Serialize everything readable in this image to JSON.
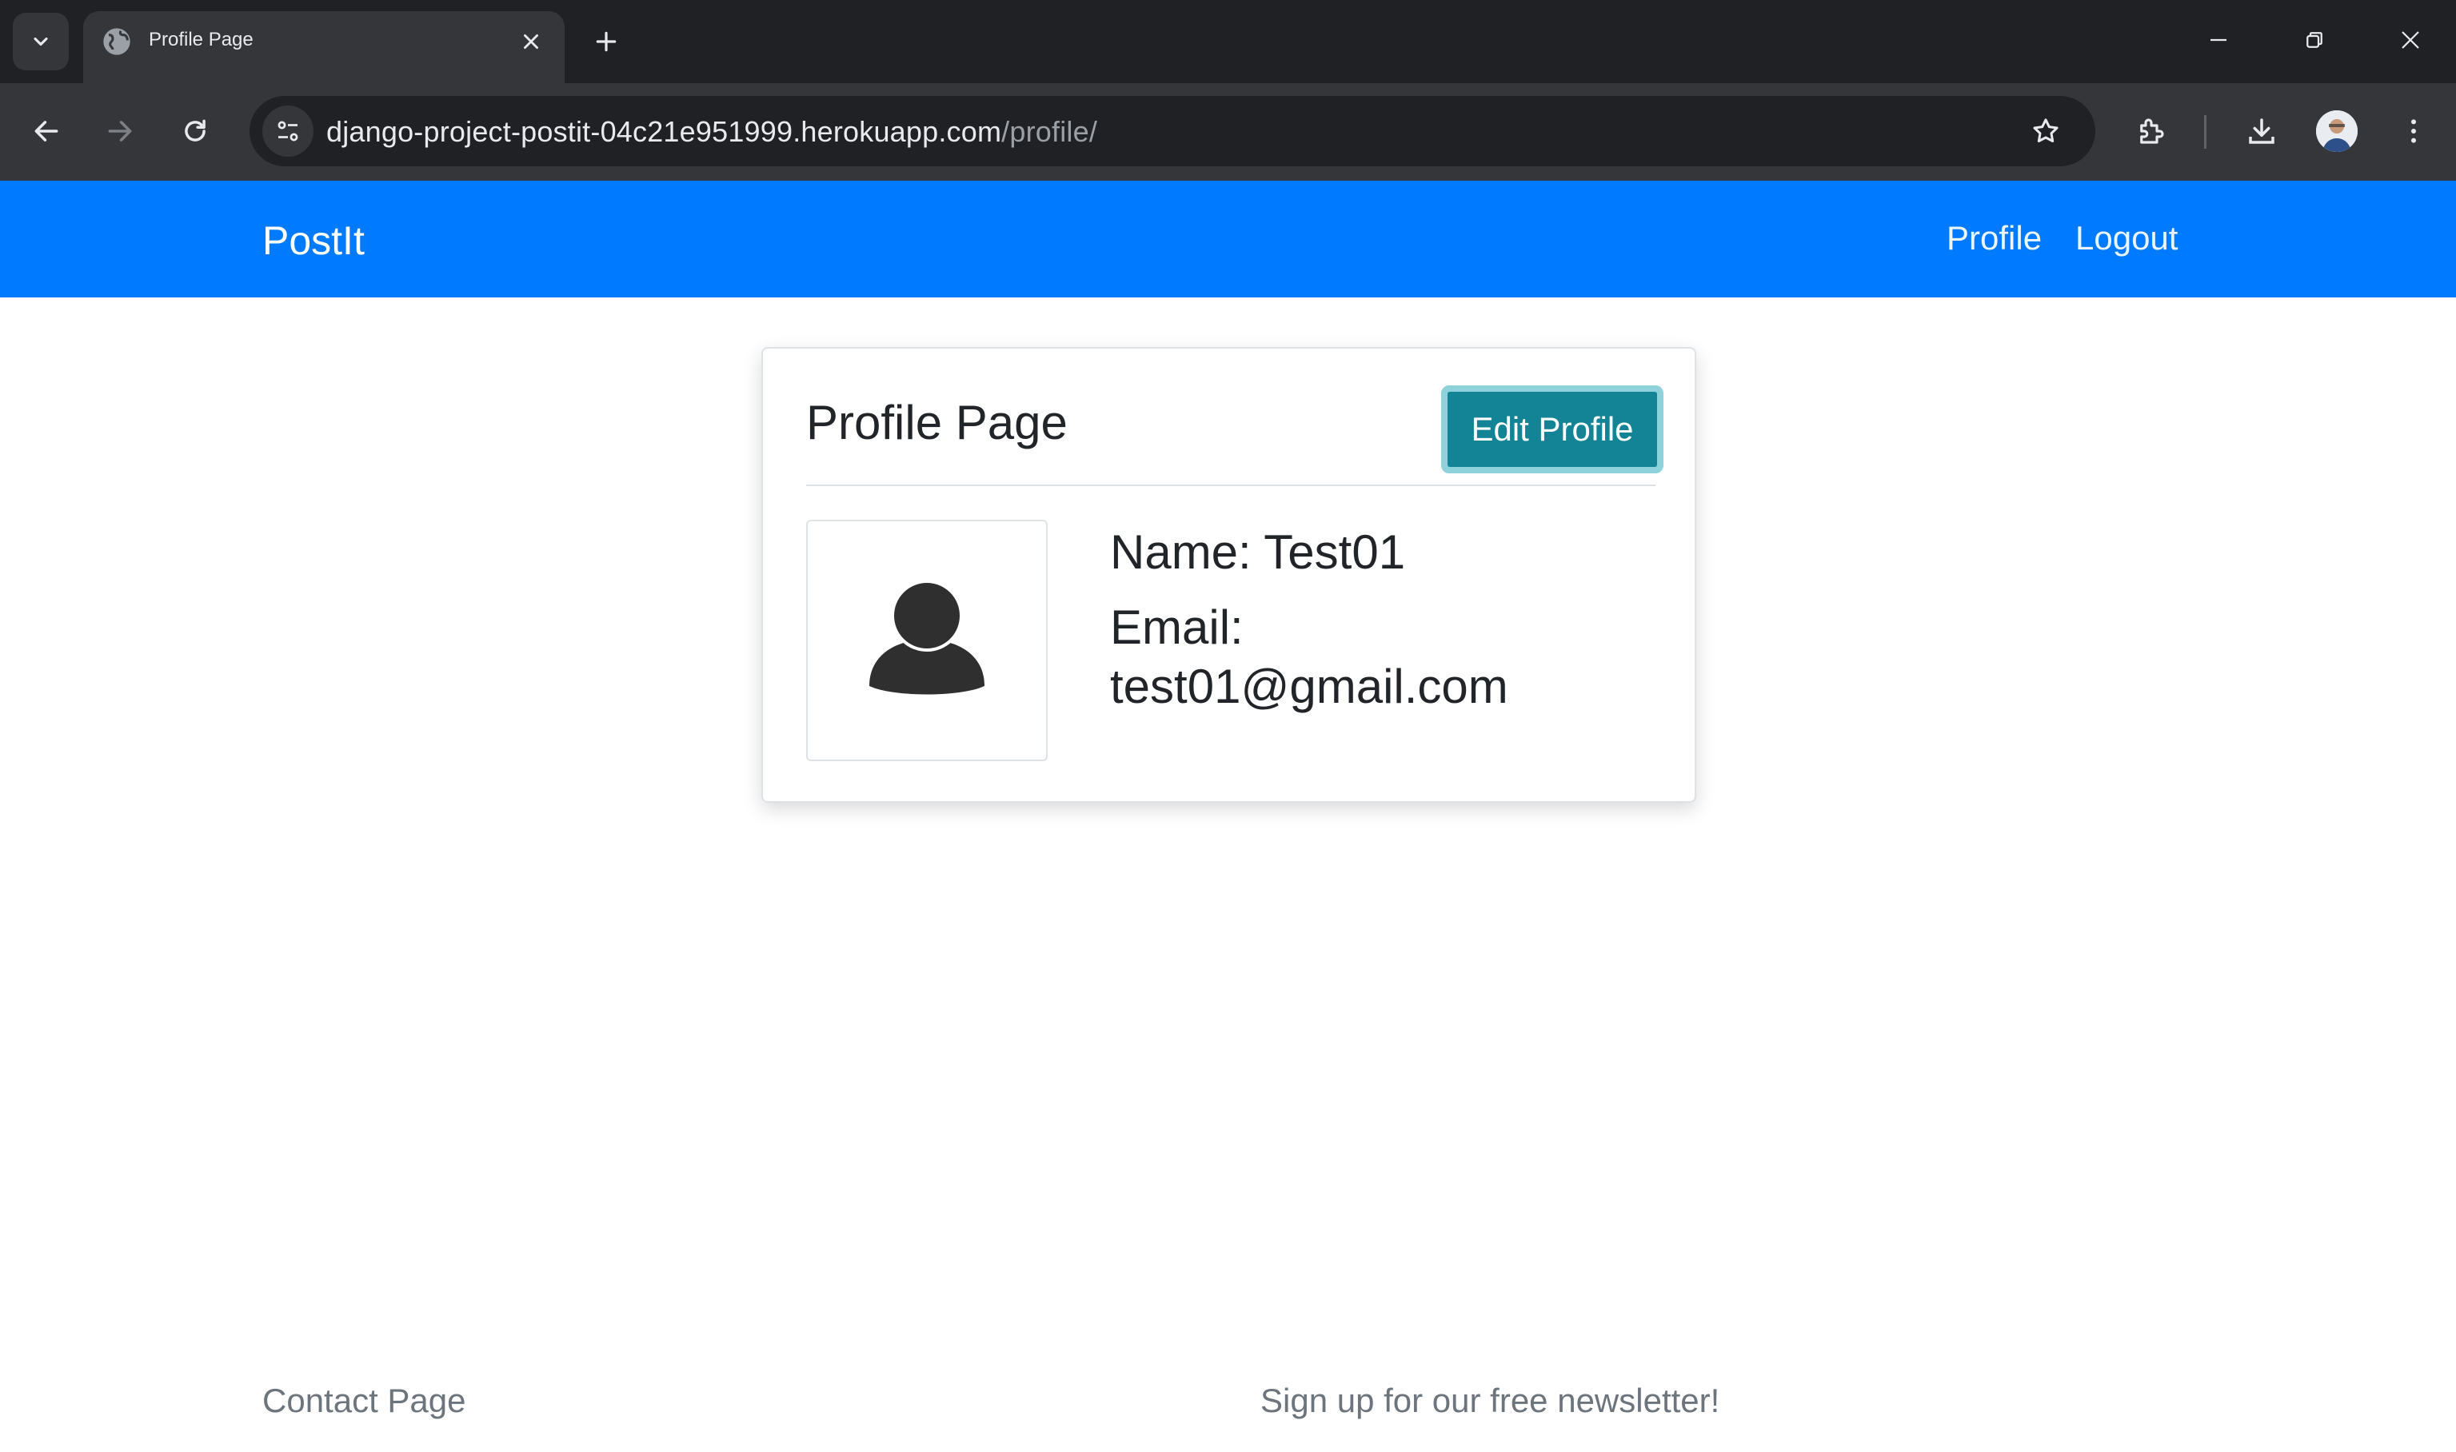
{
  "browser": {
    "tab_title": "Profile Page",
    "url_host": "django-project-postit-04c21e951999.herokuapp.com",
    "url_path": "/profile/"
  },
  "navbar": {
    "brand": "PostIt",
    "links": [
      "Profile",
      "Logout"
    ],
    "color": "#007bff"
  },
  "card": {
    "title": "Profile Page",
    "edit_button": "Edit Profile",
    "name_line": "Name: Test01",
    "email_label": "Email:",
    "email_value": "test01@gmail.com",
    "button_color": "#17a2b8"
  },
  "footer": {
    "contact": "Contact Page",
    "newsletter": "Sign up for our free newsletter!"
  },
  "icons": {
    "tab_search": "chevron-down-icon",
    "favicon": "globe-icon",
    "avatar_placeholder": "user-silhouette-icon"
  }
}
